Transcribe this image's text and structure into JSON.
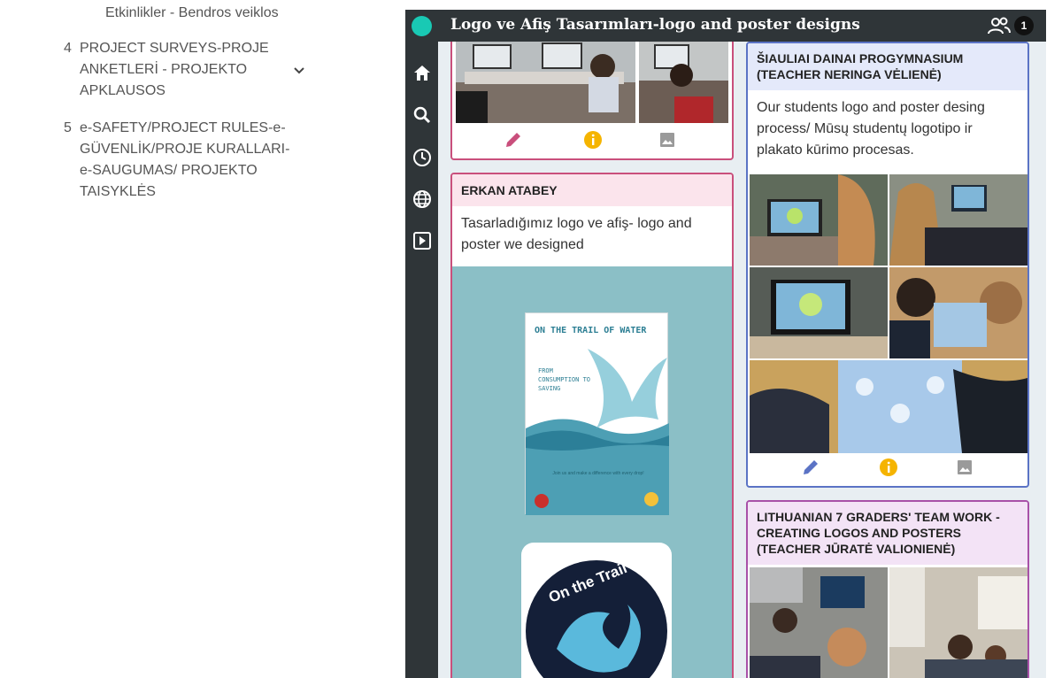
{
  "left_nav": {
    "sub_item": "Etkinlikler - Bendros veiklos",
    "items": [
      {
        "num": "4",
        "label": "PROJECT SURVEYS-PROJE ANKETLERİ - PROJEKTO APKLAUSOS"
      },
      {
        "num": "5",
        "label": "e-SAFETY/PROJECT RULES-e-GÜVENLİK/PROJE KURALLARI- e-SAUGUMAS/ PROJEKTO TAISYKLĖS"
      }
    ]
  },
  "app": {
    "title": "Logo ve Afiş Tasarımları-logo and poster designs",
    "online_count": "1"
  },
  "cards": {
    "erkan": {
      "author": "ERKAN ATABEY",
      "text": "Tasarladığımız logo ve afiş- logo and poster we designed"
    },
    "siauliai": {
      "author": "ŠIAULIAI DAINAI PROGYMNASIUM (TEACHER NERINGA VĖLIENĖ)",
      "text": "Our students logo and poster desing process/ Mūsų studentų logotipo ir plakato kūrimo procesas."
    },
    "lithuanian": {
      "author": "LITHUANIAN 7 GRADERS' TEAM WORK - CREATING LOGOS AND POSTERS (TEACHER JŪRATĖ VALIONIENĖ)"
    }
  },
  "poster": {
    "title": "ON THE TRAIL OF WATER",
    "subtitle": "FROM CONSUMPTION TO SAVING",
    "footer": "Join us and make a difference with every drop!"
  },
  "logo_text": "On the Trail of",
  "colors": {
    "topbar": "#2f3538",
    "accent": "#19c9b4",
    "pink": "#c94f7c",
    "blue": "#5b73c5",
    "purple": "#a851a8",
    "info": "#f5b400"
  }
}
